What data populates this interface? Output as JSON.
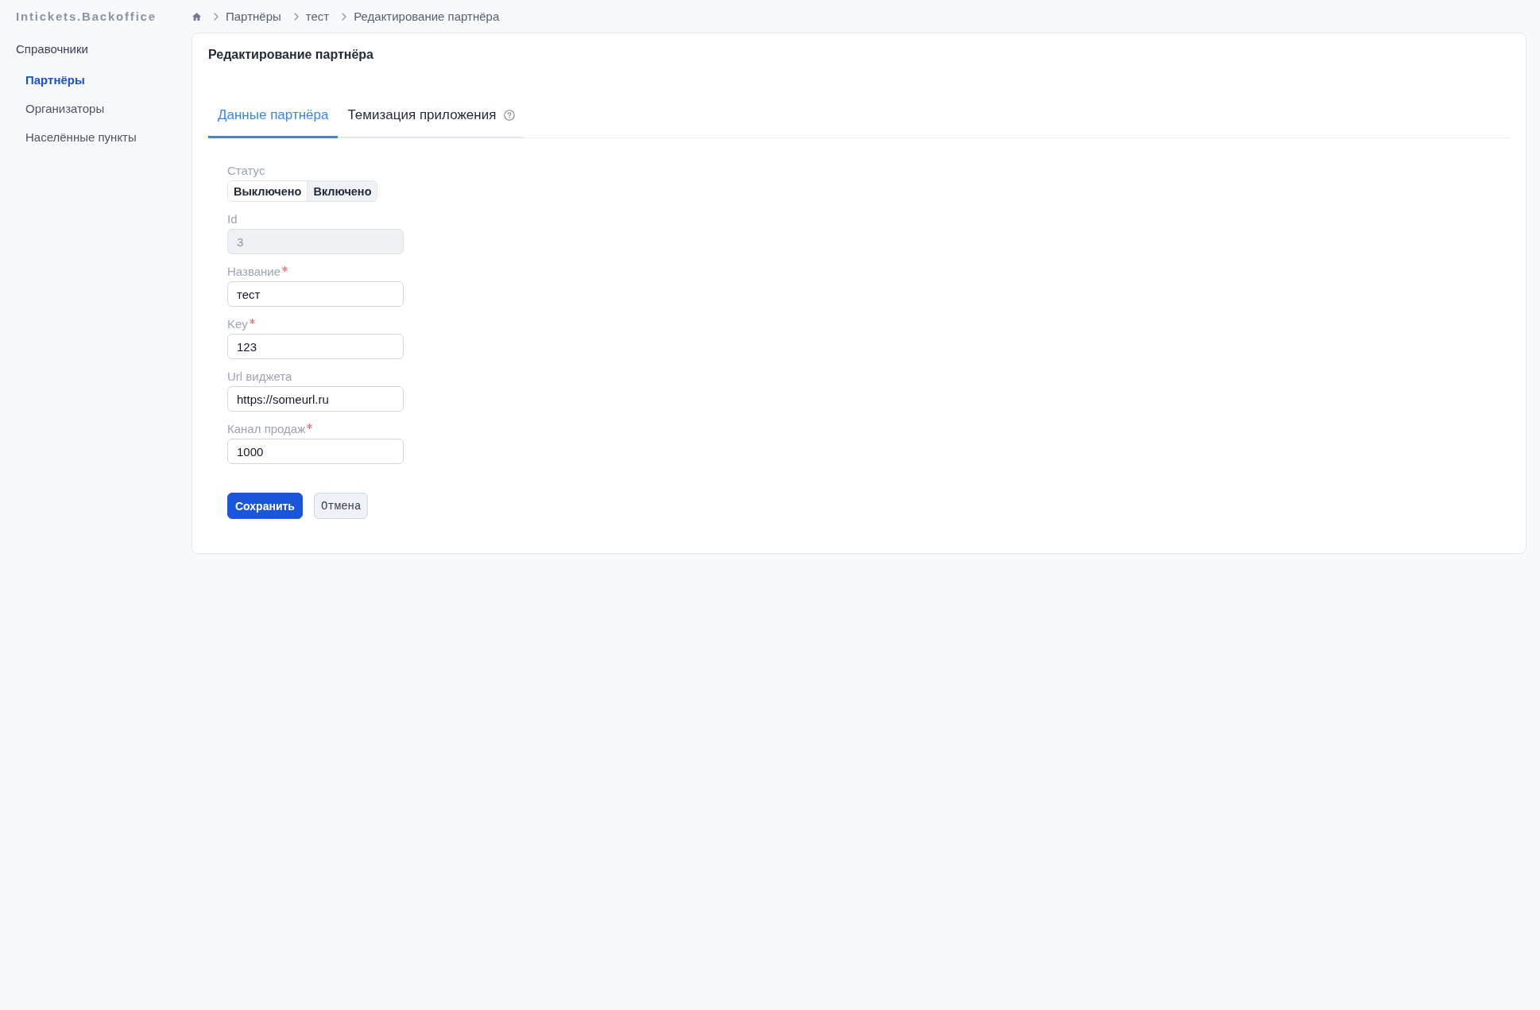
{
  "header": {
    "logo": "Intickets.Backoffice",
    "breadcrumb": [
      "Партнёры",
      "тест",
      "Редактирование партнёра"
    ]
  },
  "sidebar": {
    "section": "Справочники",
    "items": [
      {
        "label": "Партнёры",
        "selected": true
      },
      {
        "label": "Организаторы",
        "selected": false
      },
      {
        "label": "Населённые пункты",
        "selected": false
      }
    ]
  },
  "card": {
    "title": "Редактирование партнёра",
    "tabs": [
      {
        "label": "Данные партнёра",
        "selected": true,
        "help": false
      },
      {
        "label": "Темизация приложения",
        "selected": false,
        "help": true
      }
    ],
    "fields": [
      {
        "kind": "segmented",
        "label": "Статус",
        "required": false,
        "options": [
          {
            "label": "Выключено",
            "selected": true
          },
          {
            "label": "Включено",
            "selected": false
          }
        ]
      },
      {
        "kind": "input",
        "label": "Id",
        "value": "3",
        "required": false,
        "disabled": true
      },
      {
        "kind": "input",
        "label": "Название",
        "value": "тест",
        "required": true,
        "disabled": false
      },
      {
        "kind": "input",
        "label": "Key",
        "value": "123",
        "required": true,
        "disabled": false
      },
      {
        "kind": "input",
        "label": "Url виджета",
        "value": "https://someurl.ru",
        "required": false,
        "disabled": false
      },
      {
        "kind": "input",
        "label": "Канал продаж",
        "value": "1000",
        "required": true,
        "disabled": false
      }
    ],
    "buttons": [
      {
        "label": "Сохранить",
        "kind": "primary"
      },
      {
        "label": "Отмена",
        "kind": "secondary"
      }
    ]
  }
}
